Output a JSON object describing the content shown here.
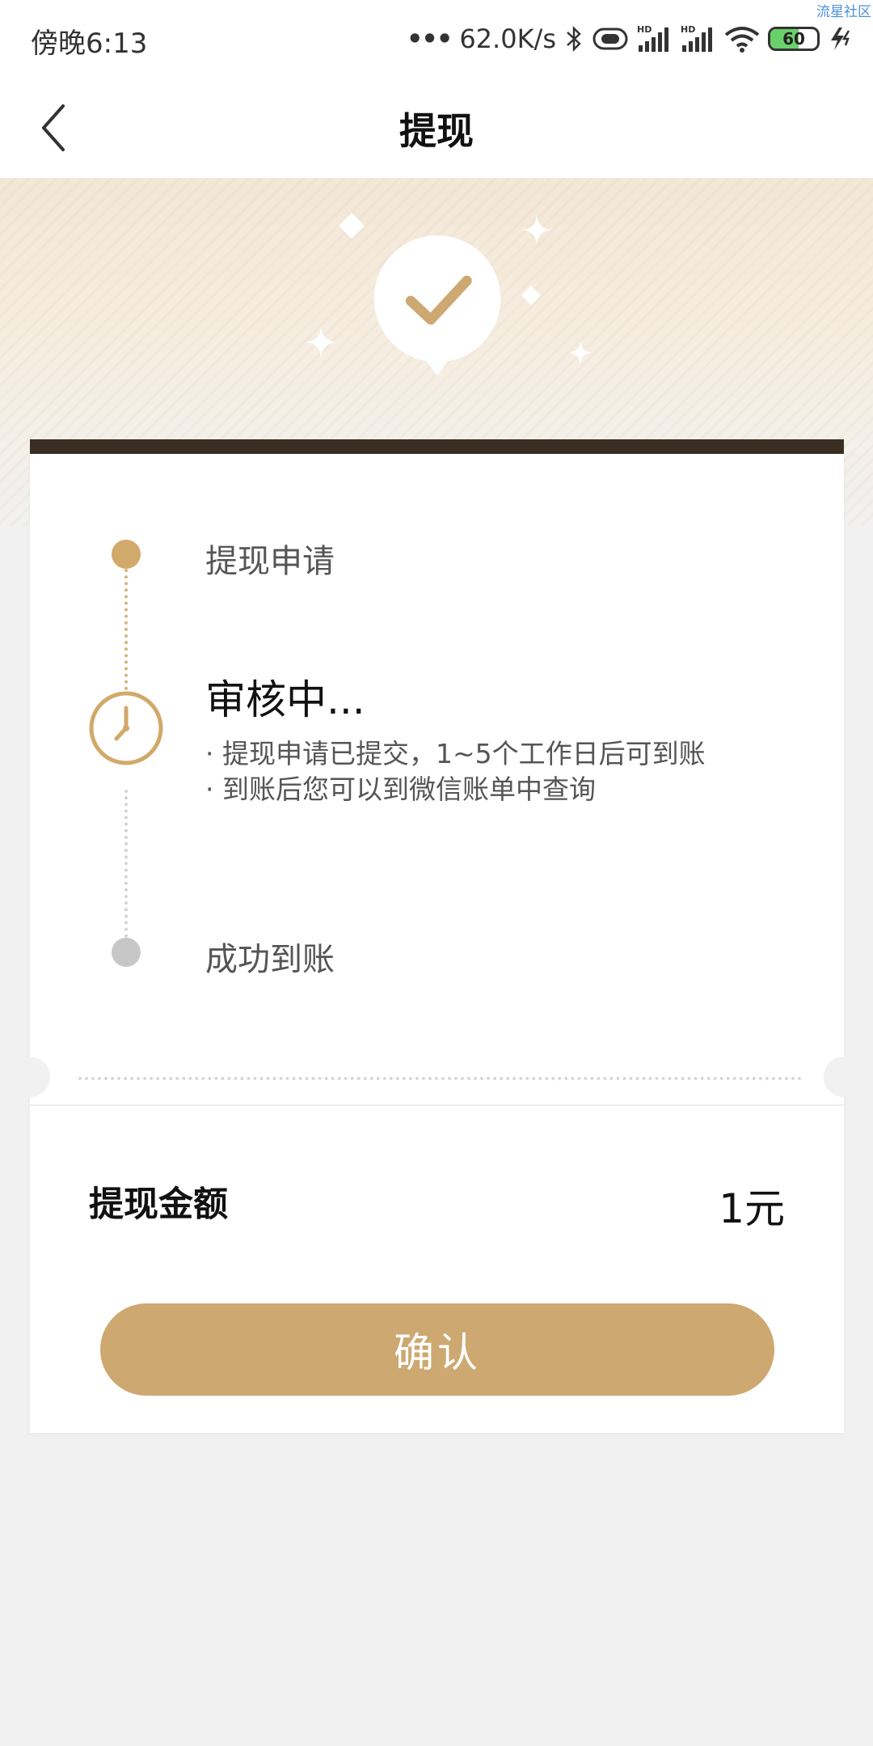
{
  "status_bar": {
    "time": "傍晚6:13",
    "network_speed": "62.0K/s",
    "battery": "60",
    "watermark": "流星社区"
  },
  "nav": {
    "title": "提现",
    "back_icon": "chevron-left-icon"
  },
  "banner": {
    "badge_icon": "checkmark-icon"
  },
  "timeline": {
    "steps": [
      {
        "label": "提现申请",
        "state": "done"
      },
      {
        "label": "审核中...",
        "state": "active",
        "notes": [
          "· 提现申请已提交，1~5个工作日后可到账",
          "· 到账后您可以到微信账单中查询"
        ]
      },
      {
        "label": "成功到账",
        "state": "pending"
      }
    ]
  },
  "amount": {
    "label": "提现金额",
    "value": "1元"
  },
  "confirm_label": "确认",
  "colors": {
    "accent": "#cda871",
    "dot_done": "#d1a96a",
    "dot_pending": "#c7c7c7",
    "card_top": "#3a2e22"
  }
}
